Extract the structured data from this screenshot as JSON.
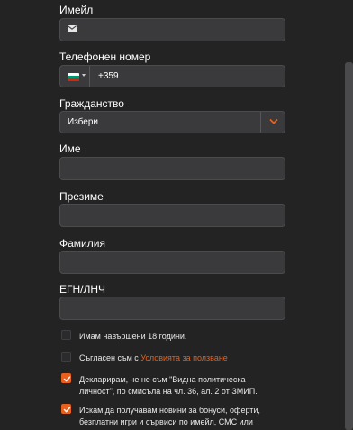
{
  "form": {
    "email": {
      "label": "Имейл",
      "value": "",
      "icon": "envelope-icon"
    },
    "phone": {
      "label": "Телефонен номер",
      "country_flag": "bulgaria-flag-icon",
      "code": "+359"
    },
    "citizenship": {
      "label": "Гражданство",
      "selected": "Избери",
      "icon": "chevron-down-icon"
    },
    "first_name": {
      "label": "Име",
      "value": ""
    },
    "middle_name": {
      "label": "Презиме",
      "value": ""
    },
    "last_name": {
      "label": "Фамилия",
      "value": ""
    },
    "egn": {
      "label": "ЕГН/ЛНЧ",
      "value": ""
    }
  },
  "checkboxes": {
    "age": {
      "label": "Имам навършени 18 години.",
      "checked": false
    },
    "terms": {
      "prefix": "Съгласен съм с ",
      "link": "Условията за ползване",
      "checked": false
    },
    "pep": {
      "line1": "Декларирам, че не съм \"Видна политическа",
      "line2": "личност\", по смисъла на чл. 36, ал. 2 от ЗМИП.",
      "checked": true
    },
    "news": {
      "line1": "Искам да получавам новини за бонуси, оферти,",
      "line2": "безплатни игри и сървиси по имейл, СМС или",
      "checked": true
    }
  },
  "colors": {
    "accent": "#e8601c",
    "background": "#232323",
    "field": "#3a3a3c"
  }
}
